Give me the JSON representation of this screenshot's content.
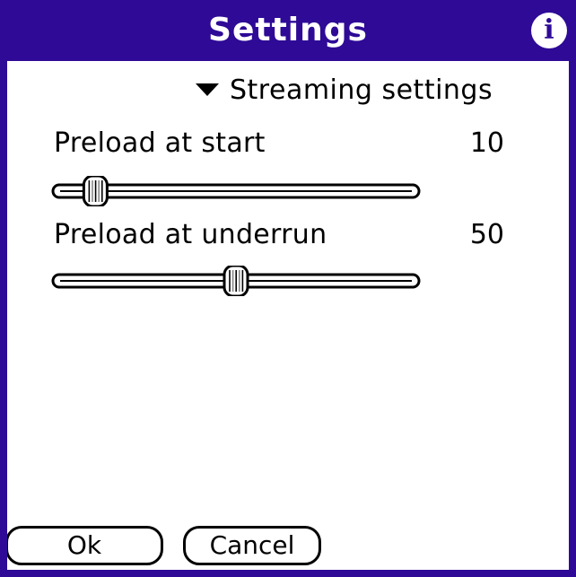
{
  "titlebar": {
    "title": "Settings",
    "info_icon": "info-icon",
    "info_glyph": "i"
  },
  "section": {
    "label": "Streaming settings",
    "icon": "triangle-down-icon"
  },
  "preload_start": {
    "label": "Preload at start",
    "value": "10",
    "slider_position": 0.09
  },
  "preload_underrun": {
    "label": "Preload at underrun",
    "value": "50",
    "slider_position": 0.5
  },
  "buttons": {
    "ok": "Ok",
    "cancel": "Cancel"
  },
  "colors": {
    "titlebar": "#2e0a96",
    "text": "#000000",
    "background": "#ffffff"
  }
}
